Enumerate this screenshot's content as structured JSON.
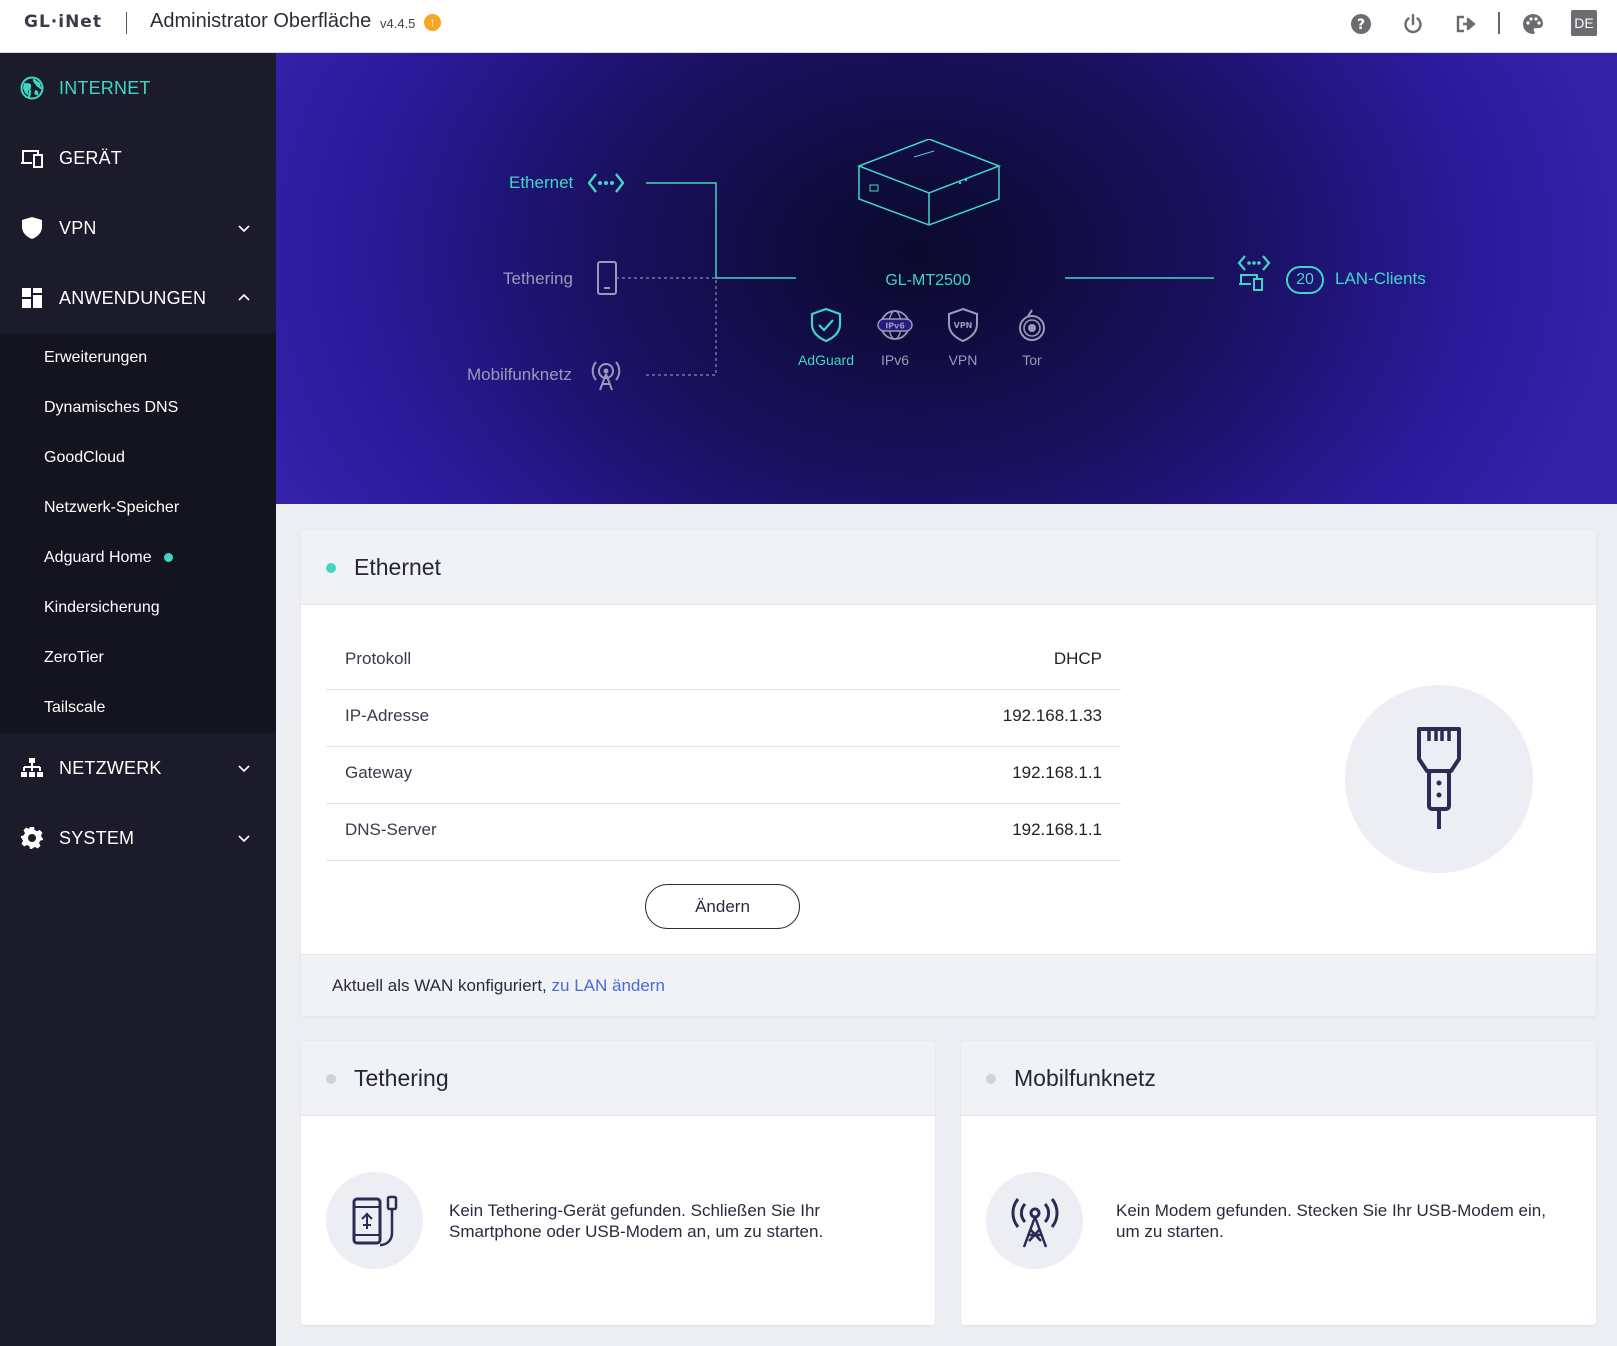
{
  "header": {
    "logo": "GL·iNet",
    "title": "Administrator Oberfläche",
    "version": "v4.4.5",
    "upgrade_symbol": "↑",
    "language": "DE",
    "icons": [
      "help-icon",
      "power-icon",
      "logout-icon",
      "theme-icon"
    ]
  },
  "sidebar": {
    "items": [
      {
        "label": "INTERNET",
        "icon": "globe-icon"
      },
      {
        "label": "GERÄT",
        "icon": "devices-icon"
      },
      {
        "label": "VPN",
        "icon": "shield-icon"
      },
      {
        "label": "ANWENDUNGEN",
        "icon": "apps-icon"
      },
      {
        "label": "NETZWERK",
        "icon": "network-icon"
      },
      {
        "label": "SYSTEM",
        "icon": "gear-icon"
      }
    ],
    "submenu": [
      "Erweiterungen",
      "Dynamisches DNS",
      "GoodCloud",
      "Netzwerk-Speicher",
      "Adguard Home",
      "Kindersicherung",
      "ZeroTier",
      "Tailscale"
    ]
  },
  "hero": {
    "sources": {
      "ethernet": "Ethernet",
      "tethering": "Tethering",
      "mobile": "Mobilfunknetz"
    },
    "device": "GL-MT2500",
    "features": {
      "adguard": "AdGuard",
      "ipv6": "IPv6",
      "vpn": "VPN",
      "tor": "Tor"
    },
    "ipv6_badge": "IPv6",
    "vpn_badge": "VPN",
    "lan_count": "20",
    "lan_label": "LAN-Clients"
  },
  "ethernet_card": {
    "title": "Ethernet",
    "rows": [
      {
        "key": "Protokoll",
        "value": "DHCP"
      },
      {
        "key": "IP-Adresse",
        "value": "192.168.1.33"
      },
      {
        "key": "Gateway",
        "value": "192.168.1.1"
      },
      {
        "key": "DNS-Server",
        "value": "192.168.1.1"
      }
    ],
    "button": "Ändern",
    "footer_text": "Aktuell als WAN konfiguriert,",
    "footer_link": "zu LAN ändern"
  },
  "tethering_card": {
    "title": "Tethering",
    "message_line1": "Kein Tethering-Gerät gefunden. Schließen Sie Ihr",
    "message_line2": "Smartphone oder USB-Modem an, um zu starten."
  },
  "mobile_card": {
    "title": "Mobilfunknetz",
    "message_line1": "Kein Modem gefunden. Stecken Sie Ihr USB-Modem ein,",
    "message_line2": "um zu starten."
  },
  "colors": {
    "accent": "#41d6c3",
    "sidebar_bg": "#1b1b2b",
    "submenu_bg": "#141421",
    "link": "#4a6bd8",
    "hero_dark": "#0a0a2c",
    "hero_purple": "#3322a8",
    "upgrade": "#f5a623"
  }
}
